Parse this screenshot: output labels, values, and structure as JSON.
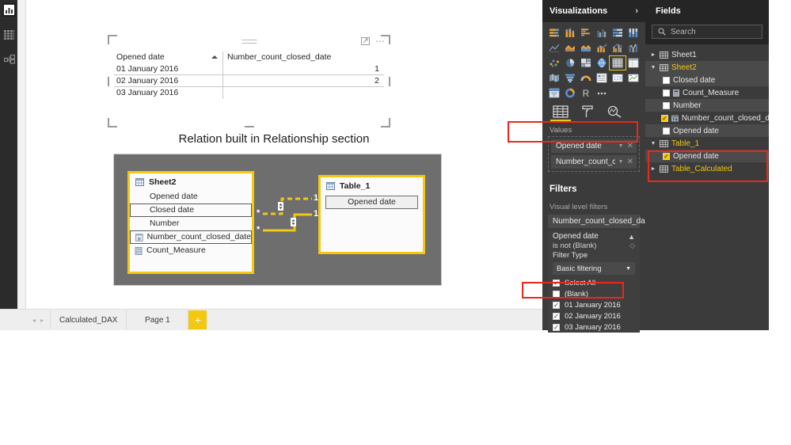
{
  "app": {
    "left_rail": [
      {
        "name": "report-view-icon",
        "label": "Report"
      },
      {
        "name": "data-view-icon",
        "label": "Data"
      },
      {
        "name": "relationships-view-icon",
        "label": "Relationships"
      }
    ]
  },
  "canvas": {
    "table_visual": {
      "columns": [
        "Opened date",
        "Number_count_closed_date"
      ],
      "sort_column": "Opened date",
      "sort_direction": "ascending",
      "rows": [
        {
          "opened_date": "01 January 2016",
          "count": "1"
        },
        {
          "opened_date": "02 January 2016",
          "count": "2"
        },
        {
          "opened_date": "03 January 2016",
          "count": ""
        }
      ],
      "header_icons": [
        "focus-mode-icon",
        "more-options-icon"
      ]
    },
    "caption": "Relation built in Relationship section",
    "diagram": {
      "tables": [
        {
          "name": "Sheet2",
          "fields": [
            {
              "label": "Opened date",
              "kind": "column",
              "boxed": false
            },
            {
              "label": "Closed date",
              "kind": "column",
              "boxed": true
            },
            {
              "label": "Number",
              "kind": "column",
              "boxed": false
            },
            {
              "label": "Number_count_closed_date",
              "kind": "calculated-column",
              "boxed": true
            },
            {
              "label": "Count_Measure",
              "kind": "measure",
              "boxed": false
            }
          ]
        },
        {
          "name": "Table_1",
          "fields": [
            {
              "label": "Opened date",
              "kind": "column",
              "boxed": true
            }
          ]
        }
      ],
      "relationships": [
        {
          "from_cardinality": "*",
          "to_cardinality": "1",
          "style": "inactive"
        },
        {
          "from_cardinality": "*",
          "to_cardinality": "1",
          "style": "active"
        }
      ]
    }
  },
  "page_tabs": {
    "nav_prev": "◂",
    "nav_next": "▸",
    "tabs": [
      "Calculated_DAX",
      "Page 1"
    ],
    "active_tab": "Page 1",
    "add_label": "+"
  },
  "visualizations": {
    "title": "Visualizations",
    "expand_icon": "chevron-right-icon",
    "gallery": [
      "stacked-bar-chart-icon",
      "stacked-column-chart-icon",
      "clustered-bar-chart-icon",
      "clustered-column-chart-icon",
      "100-stacked-bar-chart-icon",
      "100-stacked-column-chart-icon",
      "line-chart-icon",
      "area-chart-icon",
      "stacked-area-chart-icon",
      "line-stacked-column-chart-icon",
      "line-clustered-column-chart-icon",
      "ribbon-chart-icon",
      "scatter-chart-icon",
      "pie-chart-icon",
      "treemap-icon",
      "map-icon",
      "table-icon",
      "matrix-icon",
      "filled-map-icon",
      "funnel-icon",
      "gauge-icon",
      "multi-row-card-icon",
      "card-icon",
      "kpi-icon",
      "slicer-icon",
      "donut-chart-icon",
      "r-script-visual-icon",
      "more-visuals-icon"
    ],
    "selected_visual": "table-icon",
    "tabs": [
      {
        "name": "fields-tab",
        "icon": "fields-table-icon",
        "active": true
      },
      {
        "name": "format-tab",
        "icon": "paint-roller-icon",
        "active": false
      },
      {
        "name": "analytics-tab",
        "icon": "analytics-magnifier-icon",
        "active": false
      }
    ],
    "values_section": {
      "label": "Values",
      "chips": [
        {
          "label": "Opened date",
          "dropdown_icon": "chevron-down-icon",
          "remove_icon": "close-icon"
        },
        {
          "label": "Number_count_close...",
          "dropdown_icon": "chevron-down-icon",
          "remove_icon": "close-icon"
        }
      ]
    },
    "filters": {
      "title": "Filters",
      "subtitle": "Visual level filters",
      "collapsed_card": "Number_count_closed_da...",
      "open_filter": {
        "title": "Opened date",
        "collapse_icon": "chevron-up-icon",
        "clear_icon": "eraser-icon",
        "condition": "is not (Blank)",
        "filter_type_label": "Filter Type",
        "filter_type_value": "Basic filtering",
        "dropdown_icon": "chevron-down-icon",
        "items": [
          {
            "label": "Select All",
            "checked": true
          },
          {
            "label": "(Blank)",
            "checked": false
          },
          {
            "label": "01 January 2016",
            "checked": true
          },
          {
            "label": "02 January 2016",
            "checked": true
          },
          {
            "label": "03 January 2016",
            "checked": true
          }
        ]
      }
    }
  },
  "fields": {
    "title": "Fields",
    "search_placeholder": "Search",
    "search_icon": "search-icon",
    "tree": [
      {
        "type": "table",
        "label": "Sheet1",
        "expanded": false,
        "highlighted": false
      },
      {
        "type": "table",
        "label": "Sheet2",
        "expanded": true,
        "highlighted": true
      },
      {
        "type": "field",
        "label": "Closed date",
        "checked": false,
        "icon": "column-icon"
      },
      {
        "type": "field",
        "label": "Count_Measure",
        "checked": false,
        "icon": "measure-icon"
      },
      {
        "type": "field",
        "label": "Number",
        "checked": false,
        "icon": "column-icon"
      },
      {
        "type": "field",
        "label": "Number_count_closed_date",
        "checked": true,
        "icon": "calculated-column-icon"
      },
      {
        "type": "field",
        "label": "Opened date",
        "checked": false,
        "icon": "column-icon"
      },
      {
        "type": "table",
        "label": "Table_1",
        "expanded": true,
        "highlighted": true
      },
      {
        "type": "field",
        "label": "Opened date",
        "checked": true,
        "icon": "column-icon"
      },
      {
        "type": "table",
        "label": "Table_Calculated",
        "expanded": false,
        "highlighted": true
      }
    ]
  },
  "annotations": {
    "accent_yellow": "#f2c811",
    "annotation_red": "#e8291c",
    "panel_dark": "#3b3b3b",
    "panel_darker": "#252525",
    "boxes": [
      {
        "name": "values-opened-date-highlight",
        "target": "Opened date"
      },
      {
        "name": "blank-checkbox-highlight",
        "target": "(Blank)"
      },
      {
        "name": "table1-opened-date-highlight",
        "target": "Table_1 / Opened date"
      }
    ]
  }
}
